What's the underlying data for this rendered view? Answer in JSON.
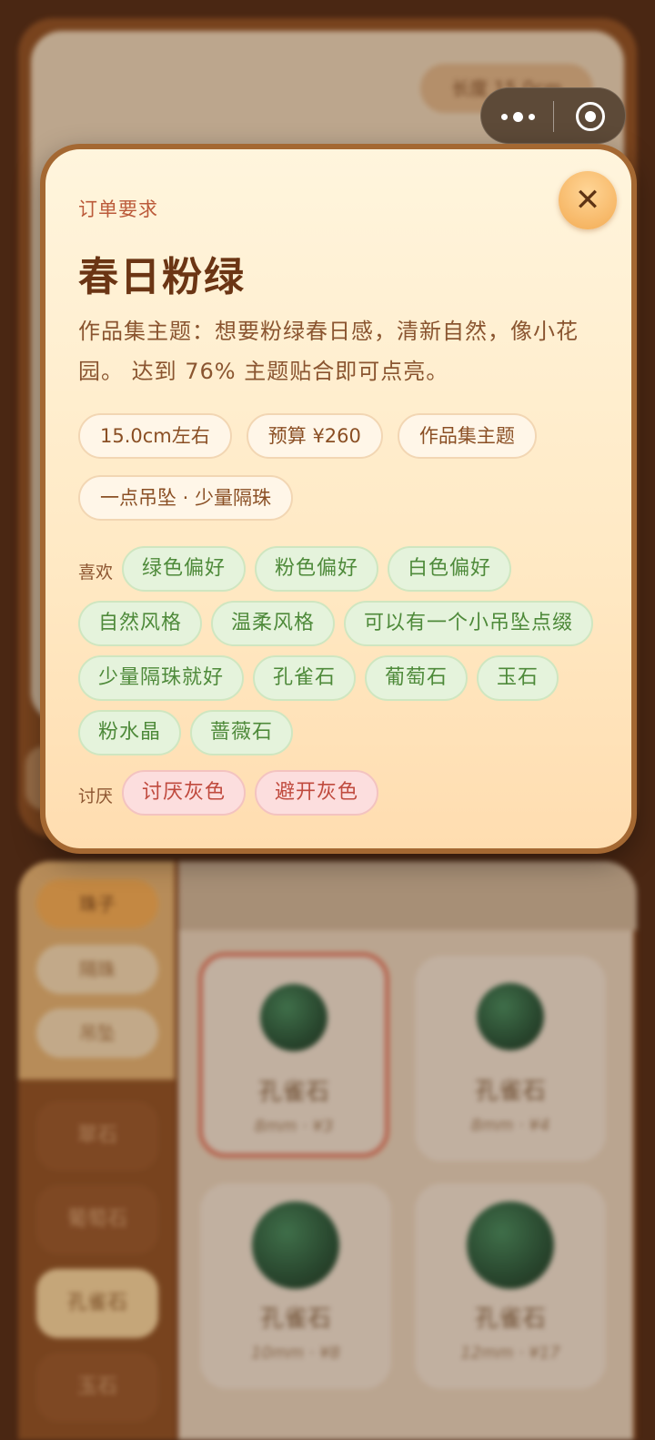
{
  "background": {
    "top_pill": "长度 15.0cm",
    "filter_chips": [
      {
        "label": "珠子",
        "active": true
      },
      {
        "label": "隔珠",
        "active": false
      },
      {
        "label": "吊坠",
        "active": false
      }
    ],
    "categories": [
      {
        "label": "翠石",
        "active": false
      },
      {
        "label": "葡萄石",
        "active": false
      },
      {
        "label": "孔雀石",
        "active": true
      },
      {
        "label": "玉石",
        "active": false
      }
    ],
    "products": [
      {
        "name": "孔雀石",
        "price": "8mm · ¥3",
        "selected": true
      },
      {
        "name": "孔雀石",
        "price": "8mm · ¥4",
        "selected": false
      },
      {
        "name": "孔雀石",
        "price": "10mm · ¥8",
        "selected": false
      },
      {
        "name": "孔雀石",
        "price": "12mm · ¥17",
        "selected": false
      }
    ]
  },
  "capsule": {
    "more_icon": "more-dots-icon",
    "close_icon": "circle-target-icon"
  },
  "modal": {
    "kicker": "订单要求",
    "title": "春日粉绿",
    "description": "作品集主题：想要粉绿春日感，清新自然，像小花园。 达到 76% 主题贴合即可点亮。",
    "close_symbol": "✕",
    "tags": [
      "15.0cm左右",
      "预算 ¥260",
      "作品集主题",
      "一点吊坠 · 少量隔珠"
    ],
    "likes_label": "喜欢",
    "likes": [
      "绿色偏好",
      "粉色偏好",
      "白色偏好",
      "自然风格",
      "温柔风格",
      "可以有一个小吊坠点缀",
      "少量隔珠就好",
      "孔雀石",
      "葡萄石",
      "玉石",
      "粉水晶",
      "蔷薇石"
    ],
    "dislikes_label": "讨厌",
    "dislikes": [
      "讨厌灰色",
      "避开灰色"
    ]
  },
  "colors": {
    "accent": "#f3ab53",
    "title": "#6b3514",
    "like_text": "#4e8a3a",
    "dislike_text": "#c04a3e"
  }
}
